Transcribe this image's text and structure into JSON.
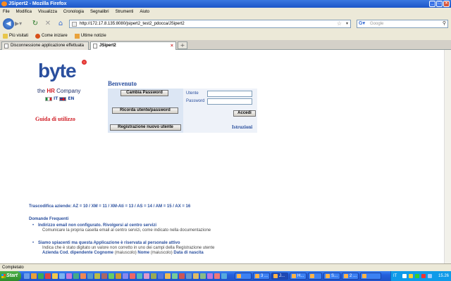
{
  "window": {
    "title": "JSipert2 - Mozilla Firefox",
    "buttons": [
      "_",
      "□",
      "×"
    ]
  },
  "menu": [
    "File",
    "Modifica",
    "Visualizza",
    "Cronologia",
    "Segnalibri",
    "Strumenti",
    "Aiuto"
  ],
  "nav": {
    "url": "http://172.17.8.135:8080/jsipert2_test2_pdocca/JSipert2",
    "search_placeholder": "Google"
  },
  "bookmarks": [
    {
      "label": "Più visitati",
      "icon": "star-icon"
    },
    {
      "label": "Come iniziare",
      "icon": "firefox-icon"
    },
    {
      "label": "Ultime notizie",
      "icon": "rss-icon"
    }
  ],
  "tabs": [
    {
      "label": "Disconnessione applicazione effettuata",
      "active": false
    },
    {
      "label": "JSipert2",
      "active": true
    }
  ],
  "page": {
    "logo": "byte",
    "tagline_pre": "the",
    "tagline_hr": "HR",
    "tagline_post": "Company",
    "lang_it": "IT",
    "lang_en": "EN",
    "guida": "Guida di utilizzo",
    "benvenuto": "Benvenuto",
    "btn_cambia": "Cambia Password",
    "btn_ricorda": "Ricorda utente/password",
    "btn_registrazione": "Registrazione nuovo utente",
    "label_utente": "Utente",
    "label_password": "Password",
    "btn_accedi": "Accedi",
    "istruzioni": "Istruzioni",
    "transcodifica": "Trascodifica aziende: AZ = 10 / XM = 11 / XM-Ati = 13 / AS = 14 / AM = 15 / AX = 16",
    "faq_title": "Domande Frequenti",
    "faq": [
      {
        "q": "Indirizzo email non configurato. Rivolgersi al centro servizi",
        "a": "Comunicare la propria casella email al centro servizi, come indicato nella documentazione"
      },
      {
        "q": "Siamo spiacenti ma questa Applicazione è riservata al personale attivo",
        "a": "Indica che è stato digitato un valore non corretto in uno dei campi della Registrazione utente",
        "b1": "Azienda Cod. dipendente Cognome",
        "b1n": "(maiuscolo)",
        "b2": "Nome",
        "b2n": "(maiuscolo)",
        "b3": "Data di nascita"
      }
    ]
  },
  "status": "Completato",
  "taskbar": {
    "start": "Start",
    "tasks": [
      "",
      "3 ...",
      "J...",
      "H...",
      "",
      "S...",
      "2 ..."
    ],
    "lang": "IT",
    "clock": "15.26"
  }
}
